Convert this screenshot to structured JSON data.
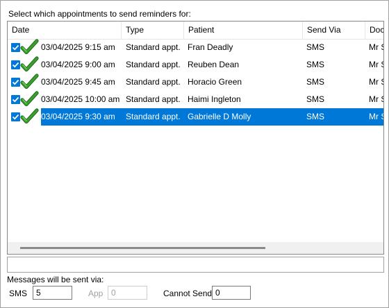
{
  "caption": "Select which appointments to send reminders for:",
  "columns": [
    "Date",
    "Type",
    "Patient",
    "Send Via",
    "Doc"
  ],
  "rows": [
    {
      "date": "03/04/2025 9:15 am",
      "type": "Standard appt.",
      "patient": "Fran Deadly",
      "via": "SMS",
      "doctor": "Mr S",
      "checked": true,
      "selected": false
    },
    {
      "date": "03/04/2025 9:00 am",
      "type": "Standard appt.",
      "patient": "Reuben Dean",
      "via": "SMS",
      "doctor": "Mr S",
      "checked": true,
      "selected": false
    },
    {
      "date": "03/04/2025 9:45 am",
      "type": "Standard appt.",
      "patient": "Horacio Green",
      "via": "SMS",
      "doctor": "Mr S",
      "checked": true,
      "selected": false
    },
    {
      "date": "03/04/2025 10:00 am",
      "type": "Standard appt.",
      "patient": "Haimi Ingleton",
      "via": "SMS",
      "doctor": "Mr S",
      "checked": true,
      "selected": false
    },
    {
      "date": "03/04/2025 9:30 am",
      "type": "Standard appt.",
      "patient": "Gabrielle D Molly",
      "via": "SMS",
      "doctor": "Mr S",
      "checked": true,
      "selected": true
    }
  ],
  "status_text": "",
  "footer": {
    "via_label": "Messages will be sent via:",
    "sms_label": "SMS",
    "sms_value": "5",
    "app_label": "App",
    "app_value": "0",
    "cannot_label": "Cannot Send",
    "cannot_value": "0"
  },
  "colors": {
    "selection": "#0078d7",
    "tick": "#3aa02d"
  },
  "icons": {
    "row_status": "green-checkmark-icon",
    "checkbox": "checkbox-checked-icon"
  }
}
